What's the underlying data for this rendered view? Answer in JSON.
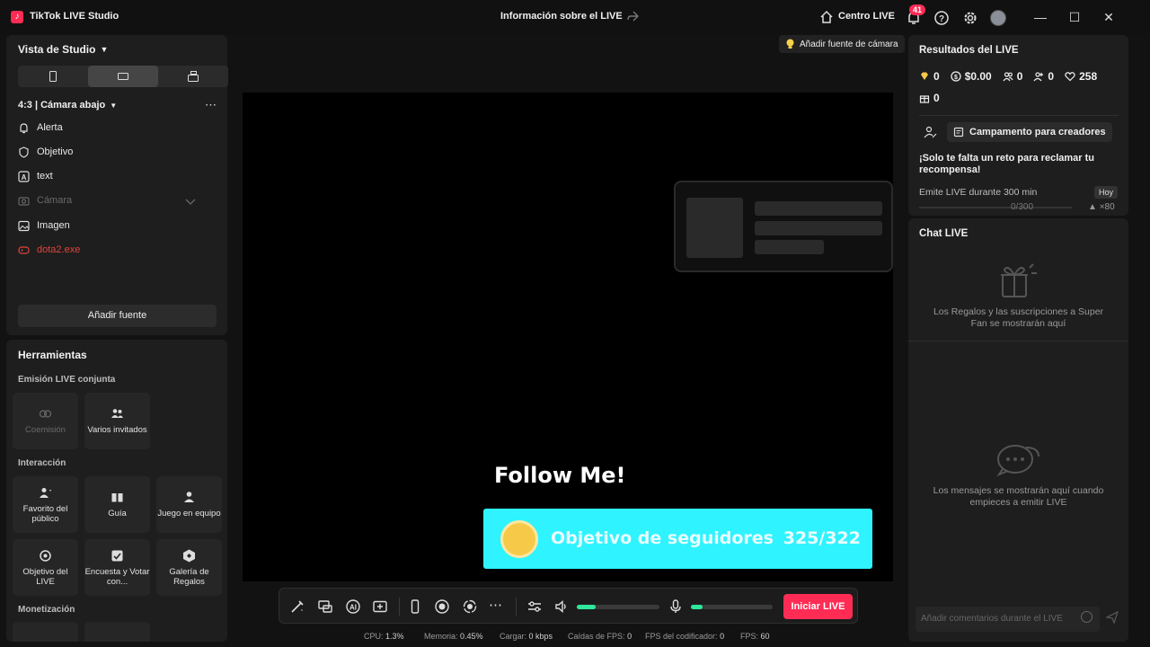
{
  "titlebar": {
    "app_name": "TikTok LIVE Studio",
    "center_title": "Información sobre el LIVE",
    "centro_live": "Centro LIVE",
    "notification_count": "41",
    "window_controls": [
      "minimize-icon",
      "maximize-icon",
      "close-icon"
    ]
  },
  "studio": {
    "title": "Vista de Studio",
    "layouts": [
      "phone-portrait-icon",
      "landscape-icon",
      "rotate-icon"
    ],
    "selected_layout": 1,
    "scene": "4:3 | Cámara abajo",
    "sources": [
      {
        "label": "Alerta",
        "icon": "bell-icon",
        "state": "normal"
      },
      {
        "label": "Objetivo",
        "icon": "shield-icon",
        "state": "normal"
      },
      {
        "label": "text",
        "icon": "text-icon",
        "state": "normal"
      },
      {
        "label": "Cámara",
        "icon": "camera-icon",
        "state": "disabled"
      },
      {
        "label": "Imagen",
        "icon": "image-icon",
        "state": "normal"
      },
      {
        "label": "dota2.exe",
        "icon": "gamepad-icon",
        "state": "error"
      }
    ],
    "add_source": "Añadir fuente"
  },
  "tools": {
    "title": "Herramientas",
    "sections": [
      {
        "label": "Emisión LIVE conjunta",
        "items": [
          {
            "label": "Coemisión",
            "state": "disabled"
          },
          {
            "label": "Varios invitados",
            "state": "normal"
          }
        ]
      },
      {
        "label": "Interacción",
        "items": [
          {
            "label": "Favorito del público"
          },
          {
            "label": "Guía"
          },
          {
            "label": "Juego en equipo"
          },
          {
            "label": "Objetivo del LIVE"
          },
          {
            "label": "Encuesta y Votar con..."
          },
          {
            "label": "Galería de Regalos"
          }
        ]
      },
      {
        "label": "Monetización",
        "items": []
      }
    ]
  },
  "preview": {
    "camera_hint": "Añadir fuente de cámara",
    "follow_text": "Follow Me!",
    "goal_label": "Objetivo de seguidores",
    "goal_count": "325/322"
  },
  "bottombar": {
    "volume_level": 0.23,
    "mic_level": 0.14,
    "go_live": "Iniciar LIVE"
  },
  "stats": [
    {
      "label": "CPU:",
      "value": "1.3%"
    },
    {
      "label": "Memoria:",
      "value": "0.45%"
    },
    {
      "label": "Cargar:",
      "value": "0 kbps"
    },
    {
      "label": "Caídas de FPS:",
      "value": "0"
    },
    {
      "label": "FPS del codificador:",
      "value": "0"
    },
    {
      "label": "FPS:",
      "value": "60"
    }
  ],
  "results": {
    "title": "Resultados del LIVE",
    "metrics": [
      {
        "icon": "diamond-icon",
        "value": "0"
      },
      {
        "icon": "coin-icon",
        "value": "$0.00"
      },
      {
        "icon": "viewers-icon",
        "value": "0"
      },
      {
        "icon": "new-followers-icon",
        "value": "0"
      },
      {
        "icon": "heart-icon",
        "value": "258"
      },
      {
        "icon": "gift-icon",
        "value": "0"
      }
    ],
    "campaign_button": "Campamento para creadores",
    "challenge_text": "¡Solo te falta un reto para reclamar tu recompensa!",
    "task": "Emite LIVE durante 300 min",
    "task_badge": "Hoy",
    "task_progress": "0/300",
    "task_reward": "×80"
  },
  "chat": {
    "title": "Chat LIVE",
    "gifts_empty": "Los Regalos y las suscripciones a Super Fan se mostrarán aquí",
    "messages_empty": "Los mensajes se mostrarán aquí cuando empieces a emitir LIVE",
    "input_placeholder": "Añadir comentarios durante el LIVE"
  }
}
